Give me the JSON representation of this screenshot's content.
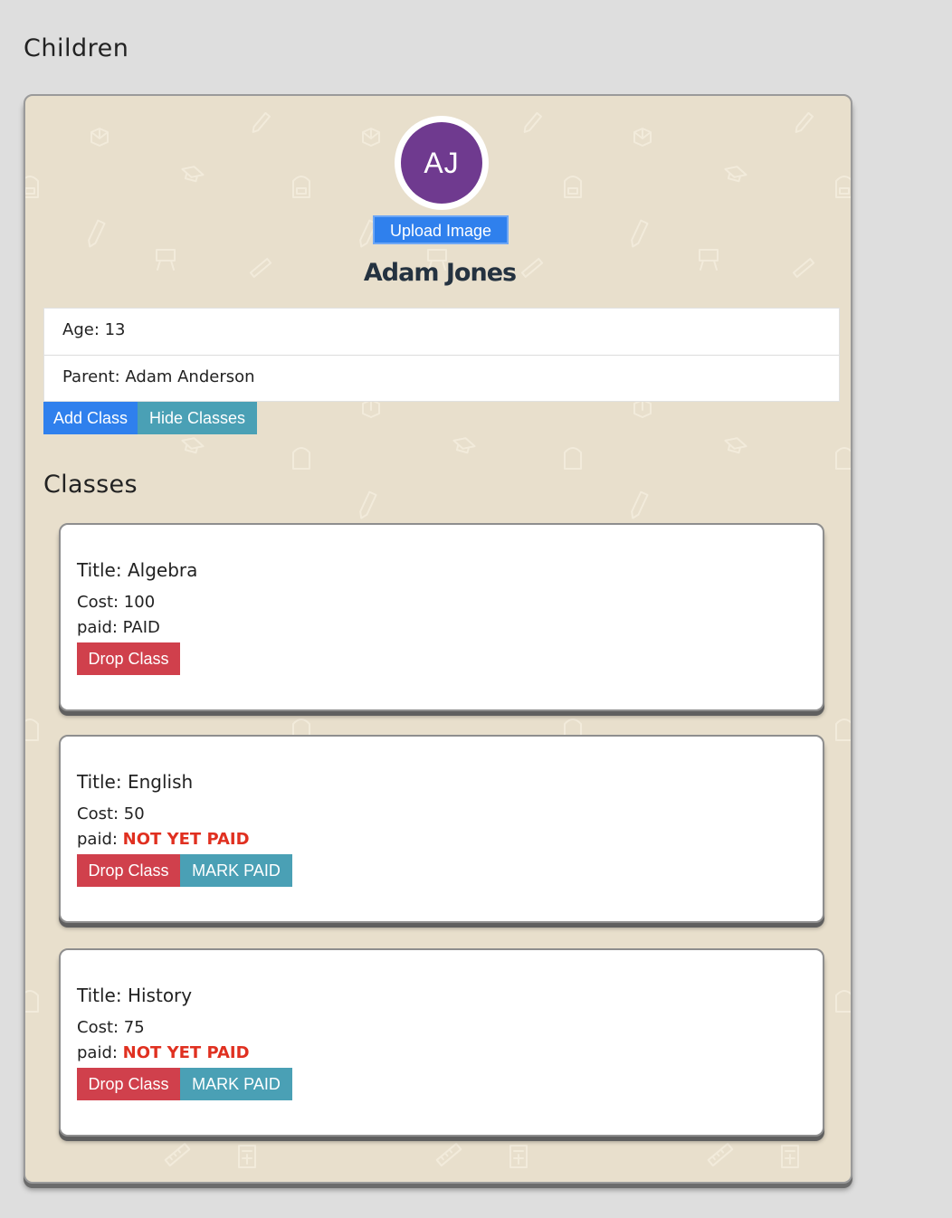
{
  "page": {
    "heading": "Children"
  },
  "child": {
    "initials": "AJ",
    "upload_label": "Upload Image",
    "name": "Adam Jones",
    "age_line": "Age: 13",
    "parent_line": "Parent: Adam Anderson",
    "add_class_label": "Add Class",
    "hide_classes_label": "Hide Classes",
    "avatar_color": "#6f3a8f"
  },
  "classes": {
    "heading": "Classes",
    "items": [
      {
        "title": "Title: Algebra",
        "cost": "Cost: 100",
        "paid_label": "paid: ",
        "paid_status": "PAID",
        "drop_label": "Drop Class"
      },
      {
        "title": "Title: English",
        "cost": "Cost: 50",
        "paid_label": "paid: ",
        "paid_status": "NOT YET PAID",
        "drop_label": "Drop Class",
        "mark_label": "MARK PAID"
      },
      {
        "title": "Title: History",
        "cost": "Cost: 75",
        "paid_label": "paid: ",
        "paid_status": "NOT YET PAID",
        "drop_label": "Drop Class",
        "mark_label": "MARK PAID"
      }
    ]
  },
  "colors": {
    "primary_blue": "#2f80ed",
    "teal": "#4aa0b5",
    "danger_red": "#d0404c",
    "unpaid_text": "#e03020",
    "card_bg": "#e8dfcc"
  }
}
